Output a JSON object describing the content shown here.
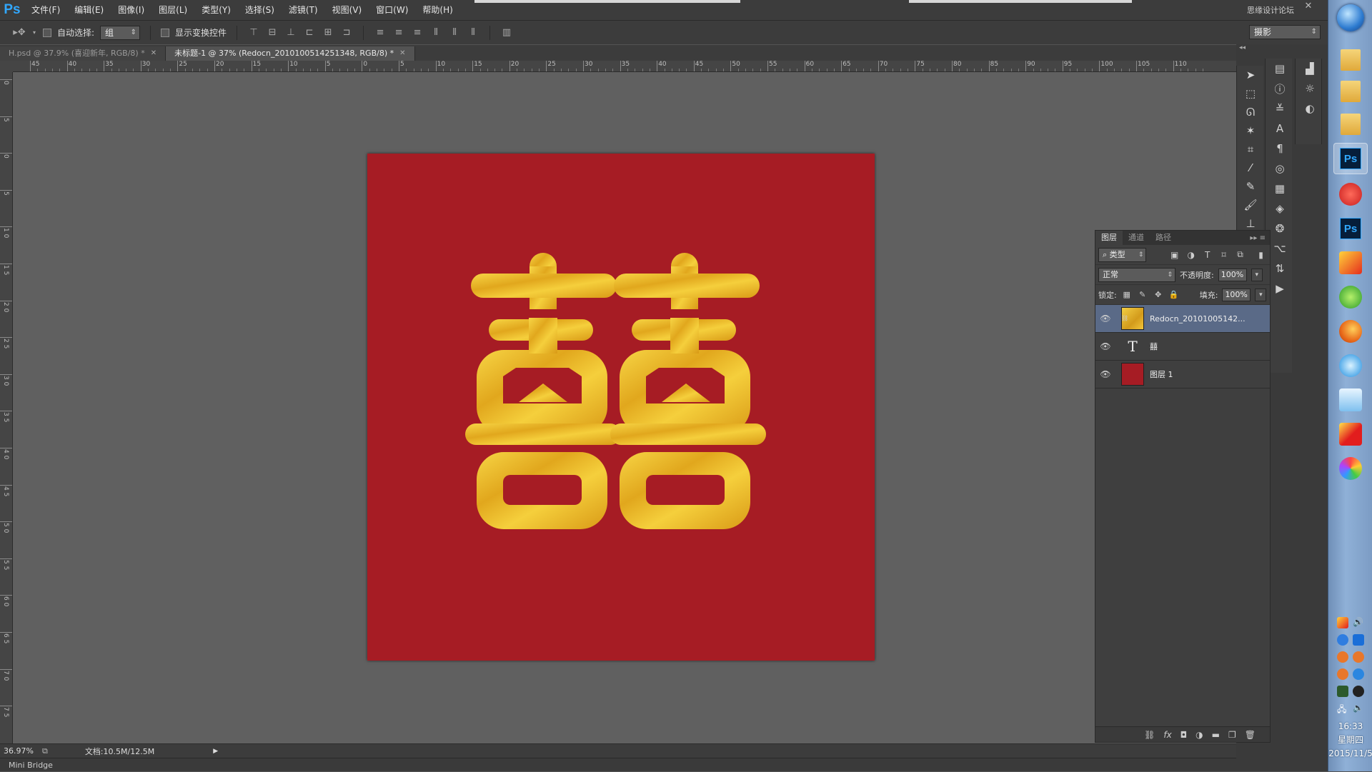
{
  "app": {
    "logo": "Ps",
    "menus": [
      "文件(F)",
      "编辑(E)",
      "图像(I)",
      "图层(L)",
      "类型(Y)",
      "选择(S)",
      "滤镜(T)",
      "视图(V)",
      "窗口(W)",
      "帮助(H)"
    ],
    "watermark": "思缘设计论坛",
    "window_controls": [
      "–",
      "□",
      "✕"
    ]
  },
  "options": {
    "auto_select_label": "自动选择:",
    "auto_select_value": "组",
    "show_transform_label": "显示变换控件",
    "workspace": "摄影"
  },
  "tabs": [
    {
      "label": "H.psd @ 37.9% (喜迎新年, RGB/8) *",
      "active": false
    },
    {
      "label": "未标题-1 @ 37% (Redocn_2010100514251348, RGB/8) *",
      "active": true
    }
  ],
  "ruler_top_labels": [
    "45",
    "40",
    "35",
    "30",
    "25",
    "20",
    "15",
    "10",
    "5",
    "0",
    "5",
    "10",
    "15",
    "20",
    "25",
    "30",
    "35",
    "40",
    "45",
    "50",
    "55",
    "60",
    "65",
    "70",
    "75",
    "80",
    "85",
    "90",
    "95",
    "100",
    "105",
    "110"
  ],
  "ruler_left_labels": [
    "0",
    "5",
    "0",
    "5",
    "1 0",
    "1 5",
    "2 0",
    "2 5",
    "3 0",
    "3 5",
    "4 0",
    "4 5",
    "5 0",
    "5 5",
    "6 0",
    "6 5",
    "7 0",
    "7 5"
  ],
  "document": {
    "background_color": "#a61c24",
    "gold_color": "#e3b21f",
    "symbol": "囍"
  },
  "status": {
    "zoom": "36.97%",
    "doc_size": "文档:10.5M/12.5M",
    "mini_bridge": "Mini Bridge"
  },
  "layers_panel": {
    "tabs": [
      "图层",
      "通道",
      "路径"
    ],
    "filter_label": "类型",
    "blend_mode": "正常",
    "opacity_label": "不透明度:",
    "opacity_value": "100%",
    "lock_label": "锁定:",
    "fill_label": "填充:",
    "fill_value": "100%",
    "layers": [
      {
        "name": "Redocn_20101005142...",
        "type": "smart",
        "selected": true
      },
      {
        "name": "囍",
        "type": "text",
        "selected": false
      },
      {
        "name": "图层 1",
        "type": "fill",
        "color": "#a61c24",
        "selected": false
      }
    ]
  },
  "taskbar": {
    "time": "16:33",
    "weekday": "星期四",
    "date": "2015/11/5"
  }
}
